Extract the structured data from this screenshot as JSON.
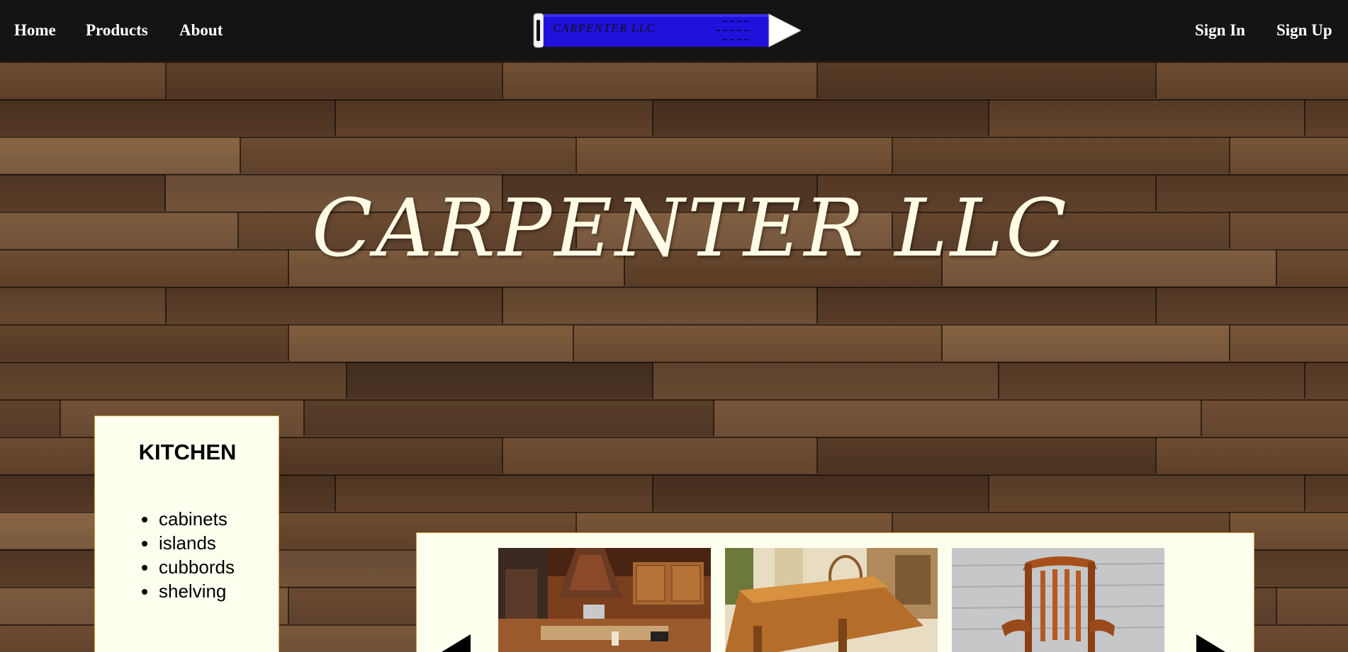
{
  "nav": {
    "home": "Home",
    "products": "Products",
    "about": "About",
    "sign_in": "Sign In",
    "sign_up": "Sign Up"
  },
  "logo": {
    "text": "CARPENTER LLC",
    "pencil_color": "#2211dd"
  },
  "hero": {
    "title": "CARPENTER LLC"
  },
  "category": {
    "title": "KITCHEN",
    "items": [
      "cabinets",
      "islands",
      "cubbords",
      "shelving"
    ]
  },
  "carousel": {
    "images": [
      "kitchen-interior-image",
      "wooden-table-image",
      "rocking-chair-image"
    ]
  },
  "colors": {
    "nav_bg": "#141414",
    "card_bg": "#fffff0",
    "card_border": "#d8a23a",
    "hero_text": "#fffbe4"
  }
}
